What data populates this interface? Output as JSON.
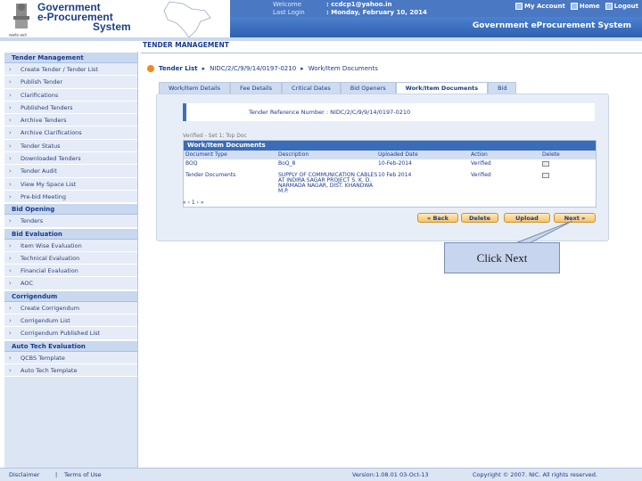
{
  "header": {
    "emblem_caption": "सत्यमेव जयते",
    "brand": [
      "Government",
      "e-Procurement",
      "System"
    ],
    "welcome_label": "Welcome",
    "welcome_value": ": ccdcp1@yahoo.in",
    "lastlogin_label": "Last Login",
    "lastlogin_value": ": Monday, February 10, 2014",
    "my_account": "My Account",
    "home": "Home",
    "logout": "Logout",
    "system_title": "Government eProcurement System"
  },
  "page_title": "TENDER MANAGEMENT",
  "sidebar": {
    "tender_management": {
      "title": "Tender Management",
      "items": [
        "Create Tender / Tender List",
        "Publish Tender",
        "Clarifications",
        "Published Tenders",
        "Archive Tenders",
        "Archive Clarifications",
        "Tender Status",
        "Downloaded Tenders",
        "Tender Audit",
        "View My Space List",
        "Pre-bid Meeting"
      ]
    },
    "bid_opening": {
      "title": "Bid Opening",
      "items": [
        "Tenders"
      ]
    },
    "bid_evaluation": {
      "title": "Bid Evaluation",
      "items": [
        "Item Wise Evaluation",
        "Technical Evaluation",
        "Financial Evaluation",
        "AOC"
      ]
    },
    "corrigendum": {
      "title": "Corrigendum",
      "items": [
        "Create Corrigendum",
        "Corrigendum List",
        "Corrigendum Published List"
      ]
    },
    "auto_tech": {
      "title": "Auto Tech Evaluation",
      "items": [
        "QCBS Template",
        "Auto Tech Template"
      ]
    }
  },
  "breadcrumb": {
    "tender_list": "Tender List",
    "tender_id": "NIDC/2/C/9/9/14/0197-0210",
    "current": "Work/Item Documents"
  },
  "tabs": [
    "Work/Item Details",
    "Fee Details",
    "Critical Dates",
    "Bid Openers",
    "Work/Item Documents",
    "Bid"
  ],
  "active_tab": "Work/Item Documents",
  "reference": "Tender Reference Number : NIDC/2/C/9/9/14/0197-0210",
  "notice": "Verified - Set 1; Top Doc",
  "documents": {
    "caption": "Work/Item Documents",
    "columns": [
      "Document Type",
      "Description",
      "Uploaded Date",
      "Action",
      "Delete"
    ],
    "rows": [
      {
        "type": "BOQ",
        "desc": "BoQ_8",
        "date": "10-Feb-2014",
        "action": "Verified"
      },
      {
        "type": "Tender Documents",
        "desc": "SUPPLY OF COMMUNICATION CABLES AT INDIRA SAGAR PROJECT S. K. D. NARMADA NAGAR, DIST. KHANDWA M.P.",
        "date": "10 Feb 2014",
        "action": "Verified"
      }
    ],
    "pager": "« ‹ 1 › »"
  },
  "buttons": {
    "back": "« Back",
    "delete": "Delete",
    "upload": "Upload",
    "next": "Next »"
  },
  "callout": "Click Next",
  "footer": {
    "disclaimer": "Disclaimer",
    "sep": "|",
    "terms": "Terms of Use",
    "version": "Version:1.08.01 03-Oct-13",
    "copyright": "Copyright © 2007. NIC. All rights reserved."
  }
}
